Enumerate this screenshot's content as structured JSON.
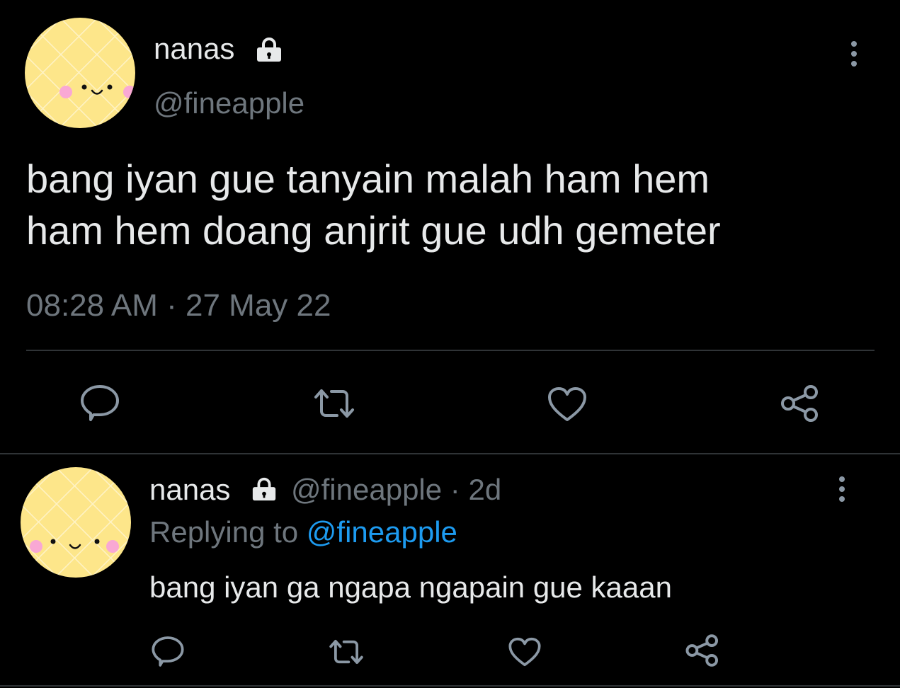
{
  "main_tweet": {
    "display_name": "nanas",
    "handle": "@fineapple",
    "text_line1": "bang iyan gue tanyain malah ham hem",
    "text_line2": "ham hem doang anjrit gue udh gemeter",
    "timestamp": "08:28 AM · 27 May 22",
    "icons": [
      "lock-icon",
      "more-icon",
      "reply-icon",
      "retweet-icon",
      "like-icon",
      "share-icon"
    ]
  },
  "reply_tweet": {
    "display_name": "nanas",
    "handle": "@fineapple",
    "separator": "·",
    "age": "2d",
    "replying_prefix": "Replying to",
    "replying_handle": "@fineapple",
    "text": "bang iyan ga ngapa ngapain gue kaaan",
    "icons": [
      "lock-icon",
      "more-icon",
      "reply-icon",
      "retweet-icon",
      "like-icon",
      "share-icon"
    ]
  },
  "colors": {
    "background": "#000000",
    "text": "#e7e9ea",
    "muted": "#6e767d",
    "link": "#1d9bf0",
    "divider": "#2f3336",
    "avatar": "#ffe082"
  }
}
